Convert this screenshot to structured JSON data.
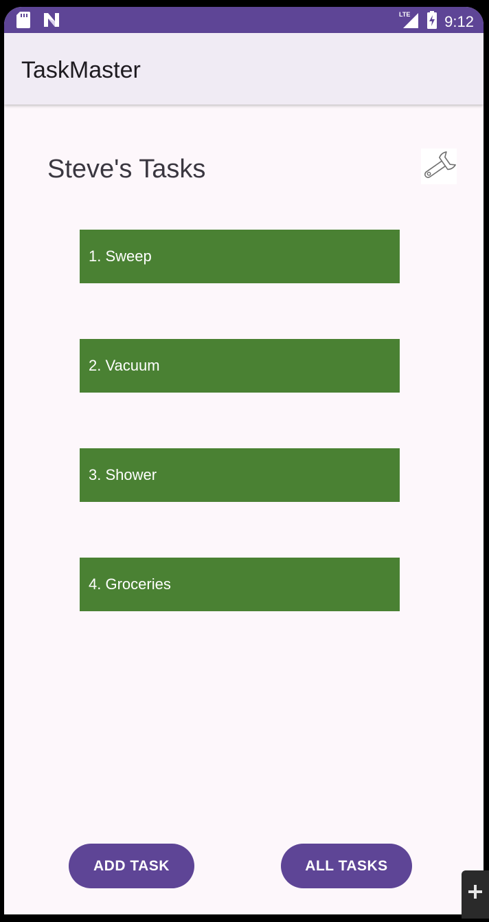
{
  "status_bar": {
    "time": "9:12",
    "network": "LTE",
    "icons": [
      "sd-card-icon",
      "n-logo-icon",
      "lte-signal-icon",
      "battery-charging-icon"
    ],
    "color": "#5e4596"
  },
  "app_bar": {
    "title": "TaskMaster"
  },
  "main": {
    "title": "Steve's Tasks",
    "settings_icon": "wrench-icon",
    "tasks": [
      {
        "label": "1. Sweep"
      },
      {
        "label": "2. Vacuum"
      },
      {
        "label": "3. Shower"
      },
      {
        "label": "4. Groceries"
      }
    ],
    "task_color": "#4a8133"
  },
  "actions": {
    "add_task_label": "ADD TASK",
    "all_tasks_label": "ALL TASKS",
    "button_color": "#5e4596"
  }
}
